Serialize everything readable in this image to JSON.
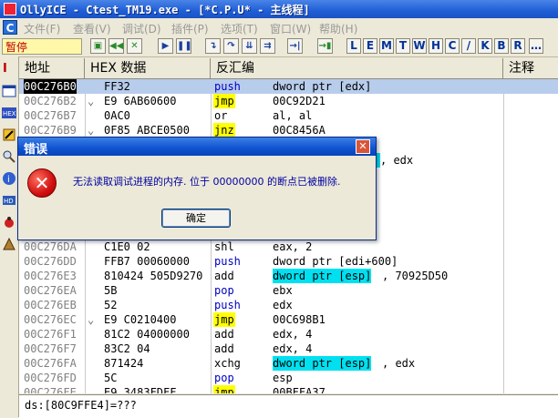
{
  "window": {
    "title": "OllyICE - Ctest_TM19.exe - [*C.P.U* -  主线程]"
  },
  "menu": [
    "文件(F)",
    "查看(V)",
    "调试(D)",
    "插件(P)",
    "选项(T)",
    "窗口(W)",
    "帮助(H)"
  ],
  "toolbar": {
    "status": "暂停",
    "letters": [
      "L",
      "E",
      "M",
      "T",
      "W",
      "H",
      "C",
      "/",
      "K",
      "B",
      "R"
    ]
  },
  "columns": [
    "地址",
    "HEX 数据",
    "反汇编",
    "注释"
  ],
  "rows": [
    {
      "addr": "00C276B0",
      "mark": "",
      "hex": "FF32",
      "mn": "push",
      "op": "dword ptr [edx]",
      "sel": true
    },
    {
      "addr": "00C276B2",
      "mark": "⌄",
      "hex": "E9 6AB60600",
      "mn": "jmp",
      "op": "00C92D21"
    },
    {
      "addr": "00C276B7",
      "mark": "",
      "hex": "0AC0",
      "mn": "or",
      "op": "al, al"
    },
    {
      "addr": "00C276B9",
      "mark": "⌄",
      "hex": "0F85 ABCE0500",
      "mn": "jnz",
      "op": "00C8456A"
    },
    {
      "addr": "",
      "mark": "",
      "hex": "",
      "mn": "",
      "op": ""
    },
    {
      "addr": "",
      "mark": "",
      "hex": "",
      "mn": "",
      "op": ""
    },
    {
      "addr": "",
      "mark": "",
      "hex": "",
      "mn": "",
      "op": ""
    },
    {
      "addr": "",
      "mark": "",
      "hex": "",
      "mn": "",
      "op": ""
    },
    {
      "addr": "",
      "mark": "",
      "hex": "",
      "mn": "",
      "op": ""
    },
    {
      "addr": "",
      "mark": "",
      "hex": "",
      "mn": "",
      "op": ""
    },
    {
      "addr": "",
      "mark": "",
      "hex": "",
      "mn": "",
      "op": ""
    },
    {
      "addr": "00C276DA",
      "mark": "",
      "hex": "C1E0 02",
      "mn": "shl",
      "op": "eax, 2"
    },
    {
      "addr": "00C276DD",
      "mark": "",
      "hex": "FFB7 00060000",
      "mn": "push",
      "op": "dword ptr [edi+600]"
    },
    {
      "addr": "00C276E3",
      "mark": "",
      "hex": "810424 505D9270",
      "mn": "add",
      "op": "dword ptr [esp]",
      "op2": ", 70925D50",
      "hl": true
    },
    {
      "addr": "00C276EA",
      "mark": "",
      "hex": "5B",
      "mn": "pop",
      "op": "ebx"
    },
    {
      "addr": "00C276EB",
      "mark": "",
      "hex": "52",
      "mn": "push",
      "op": "edx"
    },
    {
      "addr": "00C276EC",
      "mark": "⌄",
      "hex": "E9 C0210400",
      "mn": "jmp",
      "op": "00C698B1"
    },
    {
      "addr": "00C276F1",
      "mark": "",
      "hex": "81C2 04000000",
      "mn": "add",
      "op": "edx, 4"
    },
    {
      "addr": "00C276F7",
      "mark": "",
      "hex": "83C2 04",
      "mn": "add",
      "op": "edx, 4"
    },
    {
      "addr": "00C276FA",
      "mark": "",
      "hex": "871424",
      "mn": "xchg",
      "op": "dword ptr [esp]",
      "op2": ", edx",
      "hl": true
    },
    {
      "addr": "00C276FD",
      "mark": "",
      "hex": "5C",
      "mn": "pop",
      "op": "esp"
    },
    {
      "addr": "00C276FE",
      "mark": "⌄",
      "hex": "E9 3483FDFF",
      "mn": "jmp",
      "op": "00BFFA37"
    }
  ],
  "peek": {
    "op2": ", edx"
  },
  "info": "ds:[80C9FFE4]=???",
  "dialog": {
    "title": "错误",
    "message": "无法读取调试进程的内存. 位于 00000000 的断点已被删除.",
    "ok": "确定"
  }
}
